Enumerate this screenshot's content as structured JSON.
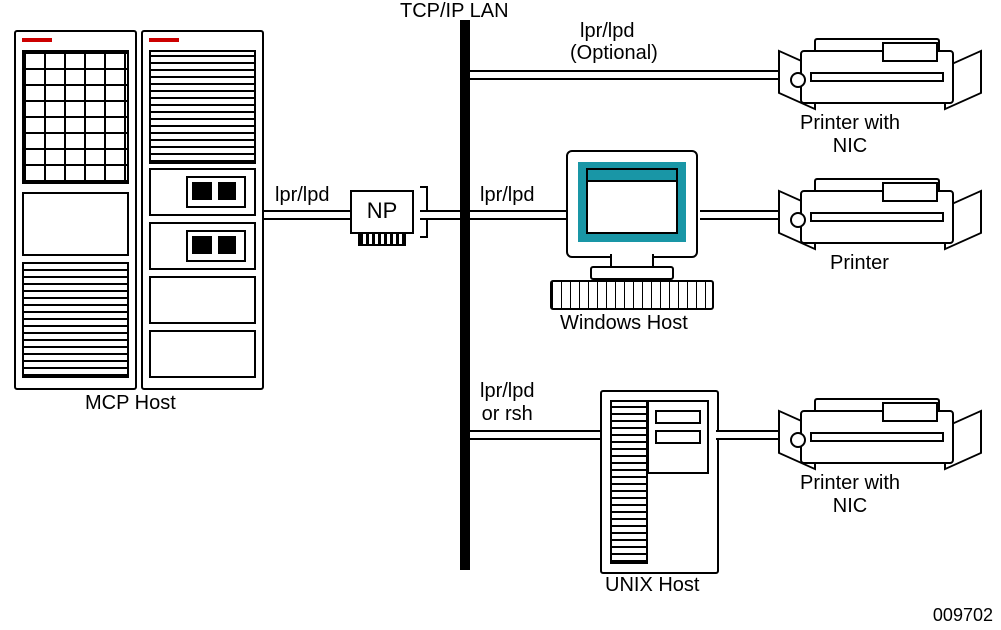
{
  "diagram": {
    "title_top": "TCP/IP LAN",
    "figure_number": "009702",
    "np_label": "NP",
    "nodes": {
      "mcp_host": "MCP Host",
      "windows_host": "Windows Host",
      "unix_host": "UNIX Host",
      "printer_nic_1": "Printer with\nNIC",
      "printer_mid": "Printer",
      "printer_nic_2": "Printer with\nNIC"
    },
    "links": {
      "mcp_to_np": "lpr/lpd",
      "lan_to_printer1_a": "lpr/lpd",
      "lan_to_printer1_b": "(Optional)",
      "lan_to_windows": "lpr/lpd",
      "lan_to_unix": "lpr/lpd\nor rsh"
    }
  }
}
